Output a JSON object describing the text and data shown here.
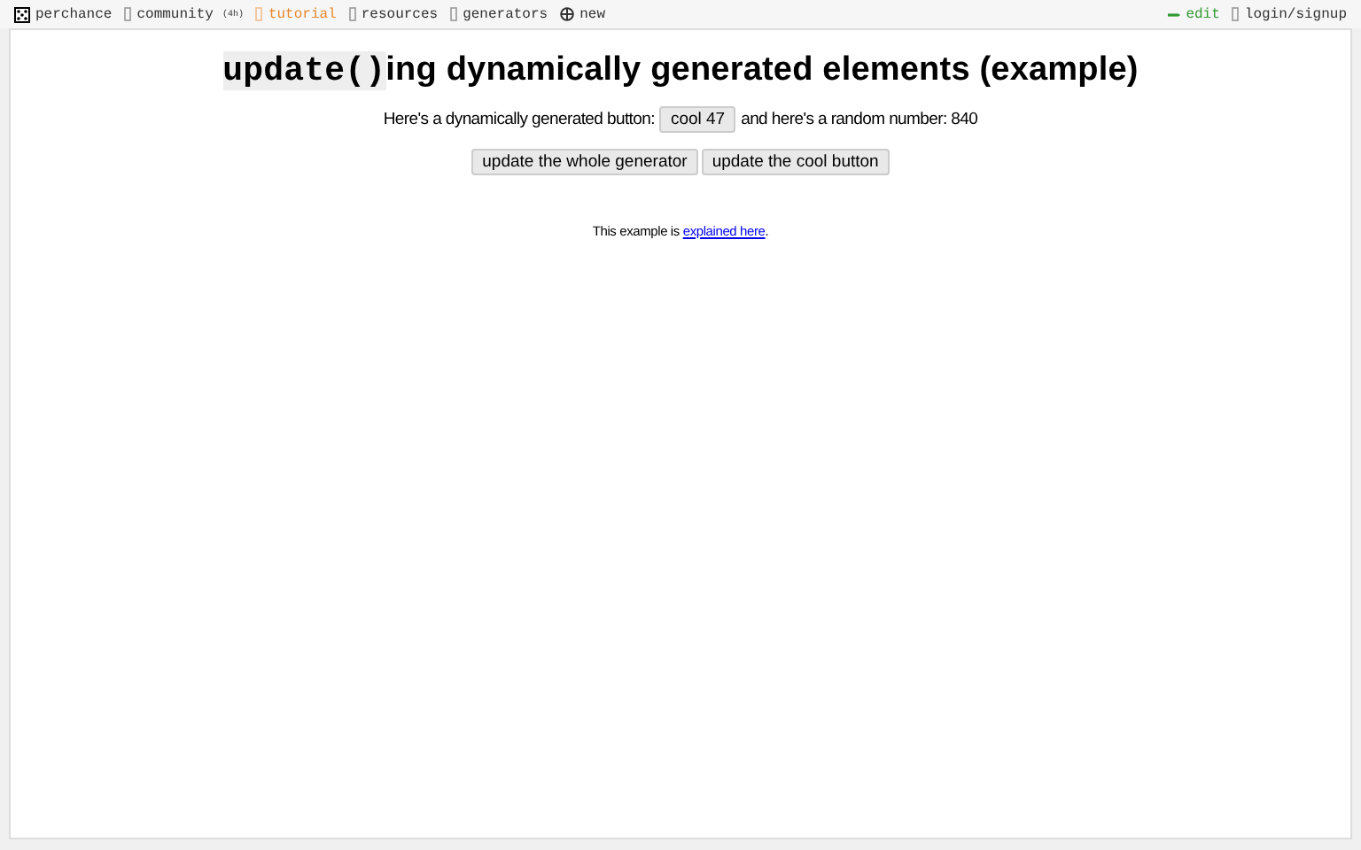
{
  "nav": {
    "left": [
      {
        "kind": "dice",
        "label": "perchance",
        "selected": false
      },
      {
        "kind": "box",
        "label": "community",
        "badge": "(4h)",
        "selected": false
      },
      {
        "kind": "box",
        "label": "tutorial",
        "selected": true
      },
      {
        "kind": "box",
        "label": "resources",
        "selected": false
      },
      {
        "kind": "box",
        "label": "generators",
        "selected": false
      },
      {
        "kind": "plus",
        "label": "new",
        "selected": false
      }
    ],
    "right": [
      {
        "kind": "pencil",
        "label": "edit",
        "selected": false
      },
      {
        "kind": "box",
        "label": "login/signup",
        "selected": false
      }
    ]
  },
  "title": {
    "code": "update()",
    "rest": "ing dynamically generated elements (example)"
  },
  "intro": {
    "before": "Here's a dynamically generated button:",
    "button": "cool 47",
    "after": "and here's a random number: 840"
  },
  "buttons": [
    "update the whole generator",
    "update the cool button"
  ],
  "note": {
    "before": "This example is ",
    "link": "explained here",
    "after": "."
  }
}
